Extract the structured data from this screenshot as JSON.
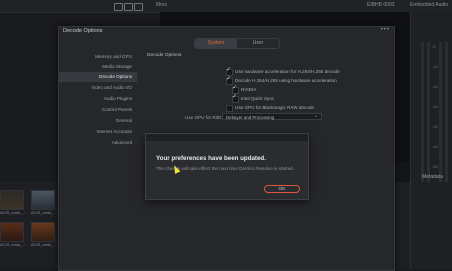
{
  "bg": {
    "top_label_left": "Mmx",
    "top_label_mid": "EIBHB 0003",
    "top_label_right": "Embedded Audio",
    "meter_scale": [
      "-5",
      "-10",
      "-15",
      "-20",
      "-30",
      "-40",
      "-50"
    ],
    "side_label": "Metadata",
    "thumbs": [
      {
        "label": "ACIS_ends_..."
      },
      {
        "label": "ACIS_ends_..."
      },
      {
        "label": "ACIS_ends_..."
      },
      {
        "label": "ACIS_ends_..."
      }
    ]
  },
  "dialog": {
    "title": "Decode Options",
    "menu_dots": "•••",
    "tabs": [
      "System",
      "User"
    ],
    "sidebar": [
      "Memory and GPU",
      "Media Storage",
      "Decode Options",
      "Video and Audio I/O",
      "Audio Plugins",
      "Control Panels",
      "General",
      "Internet Accounts",
      "Advanced"
    ],
    "section_title": "Decode Options",
    "checkboxes": [
      {
        "label": "Use hardware acceleration for H.264/H.265 decode",
        "checked": true
      },
      {
        "label": "Decode H.264/H.265 using hardware acceleration",
        "checked": true
      },
      {
        "label": "NVIDIA",
        "checked": true
      },
      {
        "label": "Intel Quick Sync",
        "checked": true
      },
      {
        "label": "Use GPU for Blackmagic RAW decode",
        "checked": false
      }
    ],
    "select_label": "Use GPU for R3D",
    "select_value": "Debayer and Processing"
  },
  "modal": {
    "title": "Your preferences have been updated.",
    "message": "The change will take effect the next time DaVinci Resolve is started.",
    "ok_label": "OK"
  }
}
